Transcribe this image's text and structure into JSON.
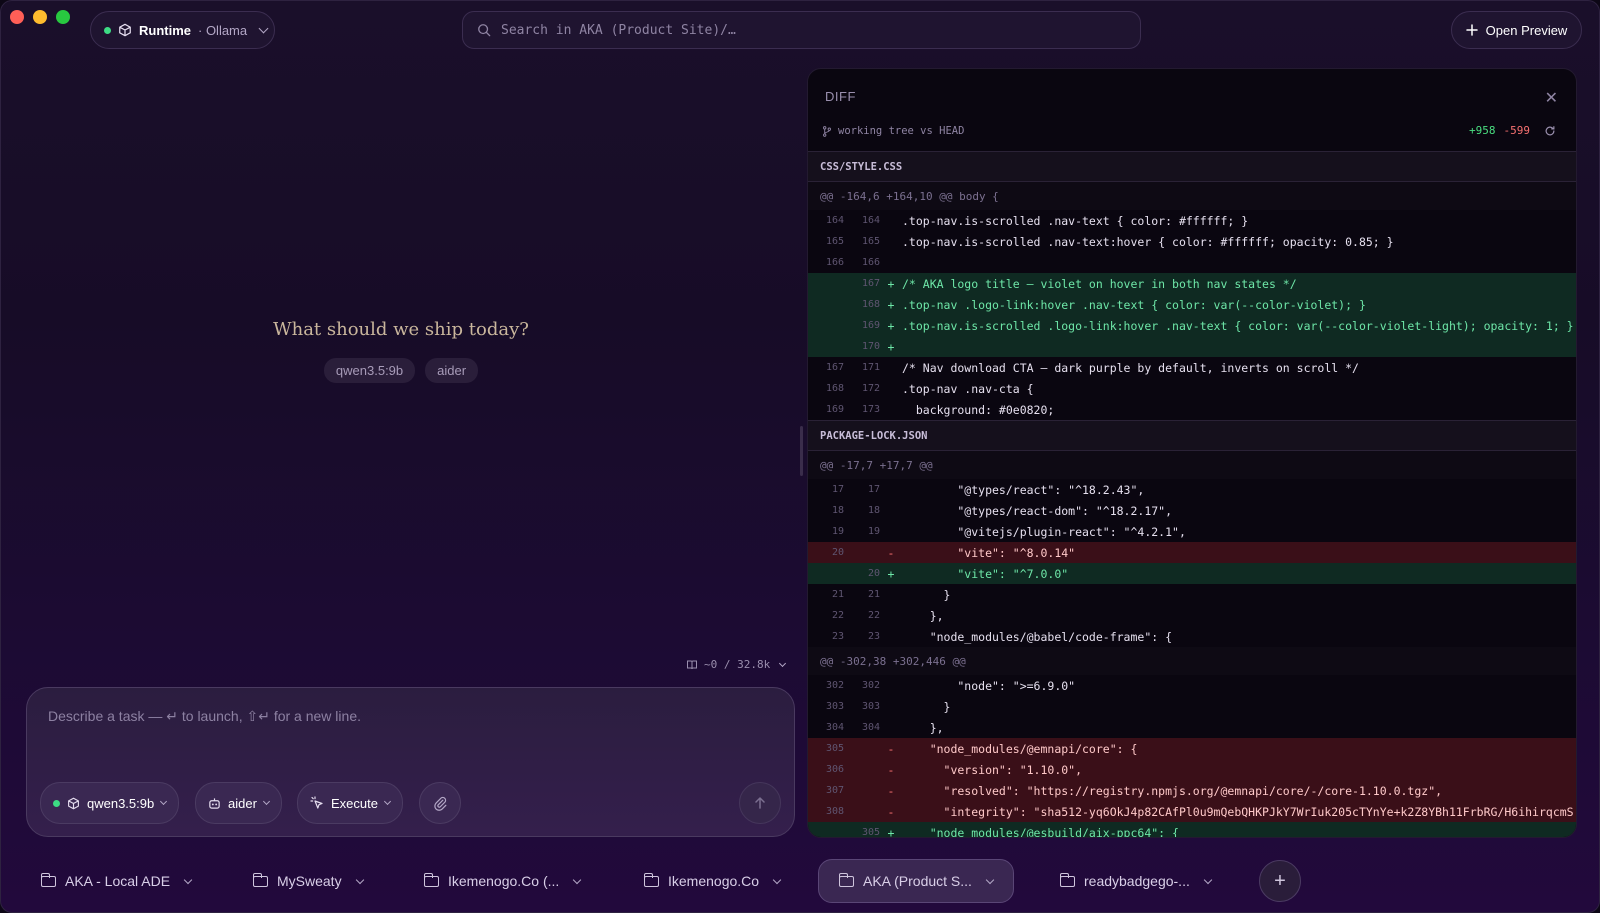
{
  "topbar": {
    "runtime_label": "Runtime",
    "runtime_sub": "· Ollama",
    "search_placeholder": "Search in AKA (Product Site)/…",
    "open_preview_label": "Open Preview"
  },
  "hero": {
    "title": "What should we ship today?",
    "tags": [
      "qwen3.5:9b",
      "aider"
    ]
  },
  "context_usage": "~0 / 32.8k",
  "composer": {
    "placeholder": "Describe a task — ↵ to launch, ⇧↵ for a new line.",
    "model_chip": "qwen3.5:9b",
    "agent_chip": "aider",
    "mode_chip": "Execute"
  },
  "diff": {
    "title": "DIFF",
    "subtitle": "working tree vs HEAD",
    "additions": "+958",
    "deletions": "-599",
    "files": [
      {
        "name": "CSS/STYLE.CSS",
        "hunks": [
          {
            "header": "@@ -164,6 +164,10 @@ body {",
            "lines": [
              {
                "type": "ctx",
                "old": "164",
                "new": "164",
                "text": ".top-nav.is-scrolled .nav-text { color: #ffffff; }"
              },
              {
                "type": "ctx",
                "old": "165",
                "new": "165",
                "text": ".top-nav.is-scrolled .nav-text:hover { color: #ffffff; opacity: 0.85; }"
              },
              {
                "type": "ctx",
                "old": "166",
                "new": "166",
                "text": ""
              },
              {
                "type": "add",
                "old": "",
                "new": "167",
                "text": "/* AKA logo title — violet on hover in both nav states */"
              },
              {
                "type": "add",
                "old": "",
                "new": "168",
                "text": ".top-nav .logo-link:hover .nav-text { color: var(--color-violet); }"
              },
              {
                "type": "add",
                "old": "",
                "new": "169",
                "text": ".top-nav.is-scrolled .logo-link:hover .nav-text { color: var(--color-violet-light); opacity: 1; }"
              },
              {
                "type": "add",
                "old": "",
                "new": "170",
                "text": ""
              },
              {
                "type": "ctx",
                "old": "167",
                "new": "171",
                "text": "/* Nav download CTA — dark purple by default, inverts on scroll */"
              },
              {
                "type": "ctx",
                "old": "168",
                "new": "172",
                "text": ".top-nav .nav-cta {"
              },
              {
                "type": "ctx",
                "old": "169",
                "new": "173",
                "text": "  background: #0e0820;"
              }
            ]
          }
        ]
      },
      {
        "name": "PACKAGE-LOCK.JSON",
        "hunks": [
          {
            "header": "@@ -17,7 +17,7 @@",
            "lines": [
              {
                "type": "ctx",
                "old": "17",
                "new": "17",
                "text": "        \"@types/react\": \"^18.2.43\","
              },
              {
                "type": "ctx",
                "old": "18",
                "new": "18",
                "text": "        \"@types/react-dom\": \"^18.2.17\","
              },
              {
                "type": "ctx",
                "old": "19",
                "new": "19",
                "text": "        \"@vitejs/plugin-react\": \"^4.2.1\","
              },
              {
                "type": "del",
                "old": "20",
                "new": "",
                "text": "        \"vite\": \"^8.0.14\""
              },
              {
                "type": "add",
                "old": "",
                "new": "20",
                "text": "        \"vite\": \"^7.0.0\""
              },
              {
                "type": "ctx",
                "old": "21",
                "new": "21",
                "text": "      }"
              },
              {
                "type": "ctx",
                "old": "22",
                "new": "22",
                "text": "    },"
              },
              {
                "type": "ctx",
                "old": "23",
                "new": "23",
                "text": "    \"node_modules/@babel/code-frame\": {"
              }
            ]
          },
          {
            "header": "@@ -302,38 +302,446 @@",
            "lines": [
              {
                "type": "ctx",
                "old": "302",
                "new": "302",
                "text": "        \"node\": \">=6.9.0\""
              },
              {
                "type": "ctx",
                "old": "303",
                "new": "303",
                "text": "      }"
              },
              {
                "type": "ctx",
                "old": "304",
                "new": "304",
                "text": "    },"
              },
              {
                "type": "del",
                "old": "305",
                "new": "",
                "text": "    \"node_modules/@emnapi/core\": {"
              },
              {
                "type": "del",
                "old": "306",
                "new": "",
                "text": "      \"version\": \"1.10.0\","
              },
              {
                "type": "del",
                "old": "307",
                "new": "",
                "text": "      \"resolved\": \"https://registry.npmjs.org/@emnapi/core/-/core-1.10.0.tgz\","
              },
              {
                "type": "del",
                "old": "308",
                "new": "",
                "text": "      \"integrity\": \"sha512-yq6OkJ4p82CAfPl0u9mQebQHKPJkY7WrIuk205cTYnYe+k2Z8YBh11FrbRG/H6ihirqcmS"
              },
              {
                "type": "add",
                "old": "",
                "new": "305",
                "text": "    \"node_modules/@esbuild/aix-ppc64\": {"
              }
            ]
          }
        ]
      }
    ]
  },
  "tabs": [
    {
      "label": "AKA - Local ADE",
      "active": false
    },
    {
      "label": "MySweaty",
      "active": false
    },
    {
      "label": "Ikemenogo.Co (...",
      "active": false
    },
    {
      "label": "Ikemenogo.Co",
      "active": false
    },
    {
      "label": "AKA (Product S...",
      "active": true
    },
    {
      "label": "readybadgego-...",
      "active": false
    }
  ],
  "colors": {
    "accent_green": "#3ddc84",
    "add": "#4ade80",
    "del": "#f87171",
    "hero_title": "#c9b69c"
  }
}
